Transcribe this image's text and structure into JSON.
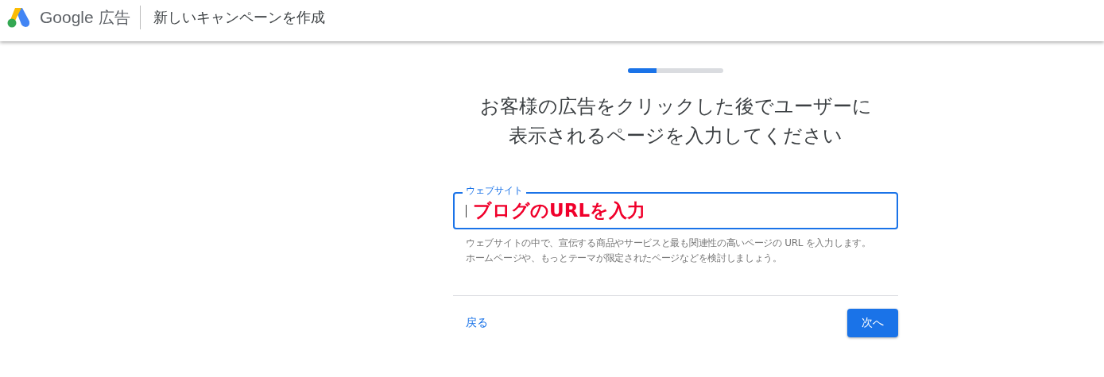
{
  "header": {
    "logo_text": "Google",
    "product": "広告",
    "page_title": "新しいキャンペーンを作成"
  },
  "progress": {
    "level": 0.3
  },
  "heading": [
    "お客様の広告をクリックした後でユーザーに",
    "表示されるページを入力してください"
  ],
  "website_field": {
    "label": "ウェブサイト",
    "value": "ブログのURLを入力",
    "focused": true
  },
  "help_text": [
    "ウェブサイトの中で、宣伝する商品やサービスと最も関連性の高いページの URL を入力します。",
    "ホームページや、もっとテーマが限定されたページなどを検討しましょう。"
  ],
  "buttons": {
    "back": "戻る",
    "next": "次へ"
  }
}
